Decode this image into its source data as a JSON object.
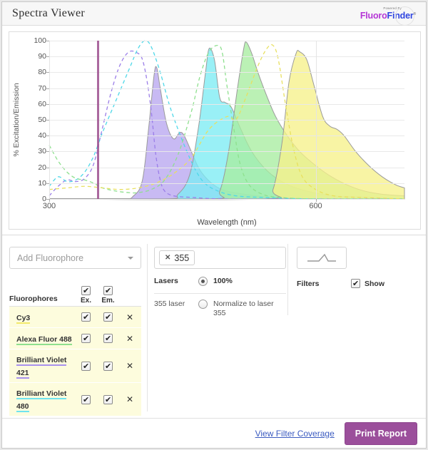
{
  "header": {
    "title": "Spectra Viewer",
    "logo": {
      "powered": "Powered By",
      "fluoro": "Fluoro",
      "finder": "Finder",
      "tm": "®"
    }
  },
  "chart_data": {
    "type": "area",
    "title": "",
    "xlabel": "Wavelength (nm)",
    "ylabel": "% Excitation/Emission",
    "xlim": [
      300,
      700
    ],
    "ylim": [
      0,
      100
    ],
    "xticks": [
      300,
      600
    ],
    "yticks": [
      0,
      10,
      20,
      30,
      40,
      50,
      60,
      70,
      80,
      90,
      100
    ],
    "grid": true,
    "legend": "none",
    "markers": [
      {
        "name": "laser-355",
        "x": 355,
        "value": 100,
        "color": "#9c4f8e",
        "label": "355"
      }
    ],
    "series": [
      {
        "name": "Brilliant Violet 421",
        "color": "#9b7ee8",
        "fill": "#b9a6ef",
        "excitation": {
          "style": "dashed",
          "points": [
            [
              300,
              2
            ],
            [
              310,
              8
            ],
            [
              320,
              12
            ],
            [
              330,
              11
            ],
            [
              340,
              13
            ],
            [
              350,
              22
            ],
            [
              360,
              45
            ],
            [
              370,
              68
            ],
            [
              380,
              85
            ],
            [
              390,
              93
            ],
            [
              400,
              92
            ],
            [
              405,
              88
            ],
            [
              410,
              75
            ],
            [
              415,
              55
            ],
            [
              420,
              28
            ],
            [
              425,
              12
            ],
            [
              430,
              5
            ],
            [
              440,
              2
            ],
            [
              460,
              1
            ],
            [
              500,
              0
            ],
            [
              600,
              0
            ],
            [
              700,
              0
            ]
          ]
        },
        "emission": {
          "style": "filled",
          "points": [
            [
              300,
              0
            ],
            [
              380,
              0
            ],
            [
              395,
              2
            ],
            [
              405,
              12
            ],
            [
              412,
              45
            ],
            [
              418,
              78
            ],
            [
              421,
              83
            ],
            [
              425,
              70
            ],
            [
              432,
              48
            ],
            [
              440,
              38
            ],
            [
              447,
              42
            ],
            [
              452,
              40
            ],
            [
              460,
              30
            ],
            [
              470,
              18
            ],
            [
              485,
              9
            ],
            [
              500,
              5
            ],
            [
              520,
              3
            ],
            [
              550,
              1
            ],
            [
              600,
              0
            ],
            [
              700,
              0
            ]
          ]
        }
      },
      {
        "name": "Brilliant Violet 480",
        "color": "#4fd8e8",
        "fill": "#7cecf4",
        "excitation": {
          "style": "dashed",
          "points": [
            [
              300,
              8
            ],
            [
              310,
              14
            ],
            [
              320,
              11
            ],
            [
              330,
              12
            ],
            [
              340,
              17
            ],
            [
              350,
              27
            ],
            [
              360,
              42
            ],
            [
              375,
              62
            ],
            [
              390,
              82
            ],
            [
              400,
              95
            ],
            [
              408,
              100
            ],
            [
              415,
              96
            ],
            [
              425,
              80
            ],
            [
              435,
              60
            ],
            [
              445,
              44
            ],
            [
              455,
              30
            ],
            [
              465,
              18
            ],
            [
              475,
              10
            ],
            [
              490,
              5
            ],
            [
              510,
              2
            ],
            [
              540,
              1
            ],
            [
              600,
              0
            ],
            [
              700,
              0
            ]
          ]
        },
        "emission": {
          "style": "filled",
          "points": [
            [
              300,
              0
            ],
            [
              430,
              0
            ],
            [
              445,
              3
            ],
            [
              458,
              15
            ],
            [
              468,
              45
            ],
            [
              476,
              80
            ],
            [
              480,
              95
            ],
            [
              486,
              88
            ],
            [
              492,
              64
            ],
            [
              498,
              61
            ],
            [
              505,
              58
            ],
            [
              515,
              45
            ],
            [
              528,
              30
            ],
            [
              545,
              18
            ],
            [
              565,
              10
            ],
            [
              590,
              5
            ],
            [
              620,
              2
            ],
            [
              660,
              1
            ],
            [
              700,
              0
            ]
          ]
        }
      },
      {
        "name": "Alexa Fluor 488",
        "color": "#8ee08e",
        "fill": "#a8eda0",
        "excitation": {
          "style": "dashed",
          "points": [
            [
              300,
              34
            ],
            [
              310,
              24
            ],
            [
              320,
              17
            ],
            [
              330,
              13
            ],
            [
              340,
              12
            ],
            [
              350,
              10
            ],
            [
              360,
              7
            ],
            [
              375,
              5
            ],
            [
              390,
              4
            ],
            [
              400,
              4
            ],
            [
              415,
              6
            ],
            [
              430,
              12
            ],
            [
              445,
              28
            ],
            [
              460,
              55
            ],
            [
              470,
              78
            ],
            [
              480,
              93
            ],
            [
              490,
              97
            ],
            [
              495,
              92
            ],
            [
              500,
              72
            ],
            [
              508,
              44
            ],
            [
              515,
              22
            ],
            [
              525,
              9
            ],
            [
              540,
              3
            ],
            [
              560,
              1
            ],
            [
              600,
              0
            ],
            [
              700,
              0
            ]
          ]
        },
        "emission": {
          "style": "filled",
          "points": [
            [
              300,
              0
            ],
            [
              480,
              0
            ],
            [
              492,
              5
            ],
            [
              502,
              30
            ],
            [
              512,
              70
            ],
            [
              519,
              95
            ],
            [
              522,
              99
            ],
            [
              528,
              92
            ],
            [
              535,
              80
            ],
            [
              545,
              65
            ],
            [
              555,
              52
            ],
            [
              568,
              40
            ],
            [
              582,
              30
            ],
            [
              598,
              22
            ],
            [
              615,
              15
            ],
            [
              635,
              9
            ],
            [
              655,
              5
            ],
            [
              675,
              3
            ],
            [
              700,
              2
            ]
          ]
        }
      },
      {
        "name": "Cy3",
        "color": "#e8e060",
        "fill": "#f6f18a",
        "excitation": {
          "style": "dashed",
          "points": [
            [
              300,
              6
            ],
            [
              320,
              7
            ],
            [
              340,
              8
            ],
            [
              360,
              7
            ],
            [
              380,
              6
            ],
            [
              400,
              7
            ],
            [
              420,
              10
            ],
            [
              440,
              16
            ],
            [
              460,
              26
            ],
            [
              480,
              44
            ],
            [
              500,
              52
            ],
            [
              510,
              50
            ],
            [
              520,
              62
            ],
            [
              535,
              84
            ],
            [
              545,
              95
            ],
            [
              552,
              97
            ],
            [
              558,
              88
            ],
            [
              566,
              60
            ],
            [
              575,
              32
            ],
            [
              585,
              14
            ],
            [
              600,
              6
            ],
            [
              620,
              2
            ],
            [
              650,
              1
            ],
            [
              700,
              0
            ]
          ]
        },
        "emission": {
          "style": "filled",
          "points": [
            [
              300,
              0
            ],
            [
              540,
              0
            ],
            [
              552,
              6
            ],
            [
              562,
              35
            ],
            [
              570,
              74
            ],
            [
              578,
              92
            ],
            [
              582,
              93
            ],
            [
              590,
              88
            ],
            [
              598,
              72
            ],
            [
              608,
              52
            ],
            [
              616,
              46
            ],
            [
              624,
              44
            ],
            [
              632,
              40
            ],
            [
              645,
              30
            ],
            [
              660,
              21
            ],
            [
              675,
              14
            ],
            [
              690,
              9
            ],
            [
              700,
              7
            ]
          ]
        }
      }
    ]
  },
  "controls": {
    "fluorophores": {
      "add_placeholder": "Add Fluorophore",
      "header_name": "Fluorophores",
      "header_ex": "Ex.",
      "header_em": "Em.",
      "header_ex_checked": true,
      "header_em_checked": true,
      "remove_icon": "✕",
      "rows": [
        {
          "name": "Cy3",
          "color": "#f2e96a",
          "ex": true,
          "em": true
        },
        {
          "name": "Alexa Fluor 488",
          "color": "#8ee08e",
          "ex": true,
          "em": true
        },
        {
          "name": "Brilliant Violet 421",
          "color": "#a891ee",
          "ex": true,
          "em": true
        },
        {
          "name": "Brilliant Violet 480",
          "color": "#6fe4ef",
          "ex": true,
          "em": true
        }
      ]
    },
    "lasers": {
      "tag_remove_icon": "✕",
      "tag_value": "355",
      "label": "Lasers",
      "option_100_label": "100%",
      "option_100_selected": true,
      "sub_label": "355 laser",
      "option_normalize_label": "Normalize to laser 355",
      "option_normalize_selected": false
    },
    "filters": {
      "label": "Filters",
      "show_label": "Show",
      "show_checked": true,
      "box_icon": "filter-slope-icon"
    }
  },
  "footer": {
    "view_filter_coverage": "View Filter Coverage",
    "print_report": "Print Report"
  }
}
